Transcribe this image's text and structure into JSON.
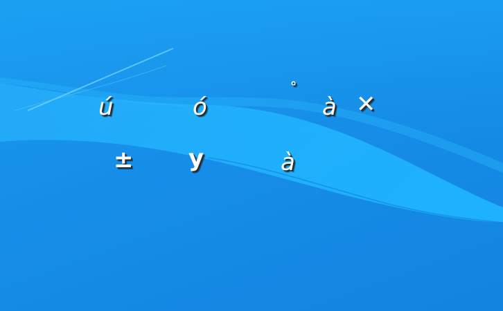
{
  "desktop": {
    "colors": {
      "background": "#168ee8",
      "wave_light": "#22b4ff",
      "wave_highlight": "#6fd0ff"
    },
    "glyphs": {
      "row1": [
        "ú",
        "ó",
        "˚",
        "à",
        "✕"
      ],
      "row2": [
        "±",
        "y",
        "à"
      ]
    }
  }
}
